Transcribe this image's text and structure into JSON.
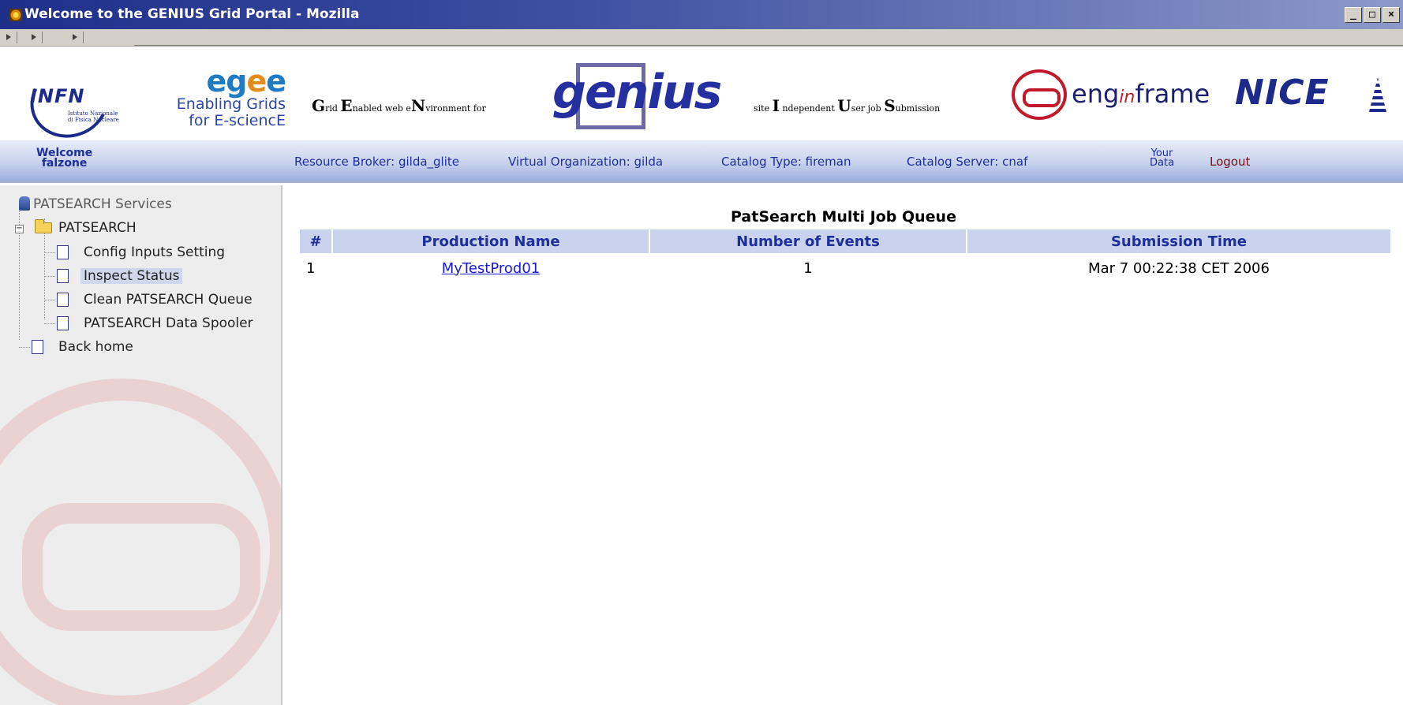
{
  "window": {
    "title": "Welcome to the GENIUS Grid Portal - Mozilla",
    "buttons": [
      "_",
      "□",
      "×"
    ]
  },
  "banner": {
    "infn": {
      "name": "INFN",
      "subtitle_line1": "Istituto Nazionale",
      "subtitle_line2": "di Fisica Nucleare"
    },
    "egee": {
      "name": "egee",
      "line1": "Enabling Grids",
      "line2": "for E-sciencE"
    },
    "genius_acronym": {
      "G": "G",
      "g_rest": "rid ",
      "E": "E",
      "e_rest": "nabled web e",
      "N": "N",
      "n_rest": "vironment for"
    },
    "genius_logo": "genius",
    "site_acronym": {
      "a": "site ",
      "I": "I",
      "i_rest": " ndependent ",
      "U": "U",
      "u_rest": "ser job ",
      "S": "S",
      "s_rest": "ubmission"
    },
    "enginframe": {
      "pre": "eng",
      "in": "in",
      "post": "frame"
    },
    "nice": "NICE"
  },
  "nav": {
    "welcome_line1": "Welcome",
    "welcome_line2": "falzone",
    "resource_broker": "Resource Broker: gilda_glite",
    "virtual_org": "Virtual Organization: gilda",
    "catalog_type": "Catalog Type: fireman",
    "catalog_server": "Catalog Server: cnaf",
    "your_data_line1": "Your",
    "your_data_line2": "Data",
    "logout": "Logout"
  },
  "sidebar": {
    "services_title": "PATSEARCH Services",
    "root_folder": "PATSEARCH",
    "items": [
      {
        "label": "Config Inputs Setting"
      },
      {
        "label": "Inspect Status",
        "selected": true
      },
      {
        "label": "Clean PATSEARCH Queue"
      },
      {
        "label": "PATSEARCH Data Spooler"
      }
    ],
    "back_home": "Back home"
  },
  "main": {
    "title": "PatSearch Multi Job Queue",
    "columns": [
      "#",
      "Production Name",
      "Number of Events",
      "Submission Time"
    ],
    "rows": [
      {
        "index": "1",
        "production_name": "MyTestProd01",
        "events": "1",
        "submission_time": "Mar 7 00:22:38 CET 2006"
      }
    ]
  },
  "colors": {
    "nav_blue": "#1d2f9a",
    "header_bg": "#c9d3ee",
    "logout_red": "#7a1010",
    "link_blue": "#1a1ad8"
  }
}
